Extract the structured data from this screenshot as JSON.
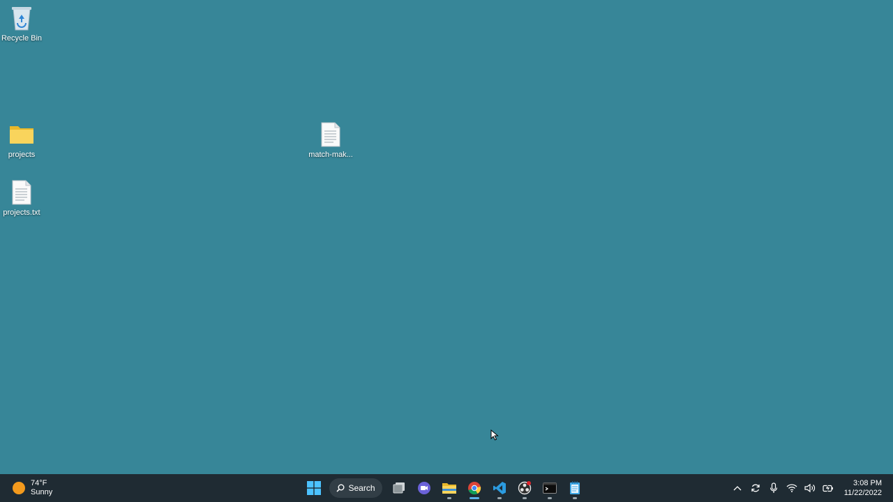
{
  "desktop": {
    "icons": [
      {
        "label": "Recycle Bin"
      },
      {
        "label": "projects"
      },
      {
        "label": "projects.txt"
      },
      {
        "label": "match-mak..."
      }
    ]
  },
  "taskbar": {
    "weather": {
      "temp": "74°F",
      "condition": "Sunny"
    },
    "search_label": "Search",
    "apps": [
      "start-icon",
      "task-view-icon",
      "teams-chat-icon",
      "file-explorer-icon",
      "chrome-icon",
      "vscode-icon",
      "obs-icon",
      "terminal-icon",
      "notepad-icon"
    ],
    "clock": {
      "time": "3:08 PM",
      "date": "11/22/2022"
    }
  },
  "colors": {
    "wallpaper": "#378698",
    "taskbar": "#1f2b33",
    "accent": "#5ab0e8"
  }
}
